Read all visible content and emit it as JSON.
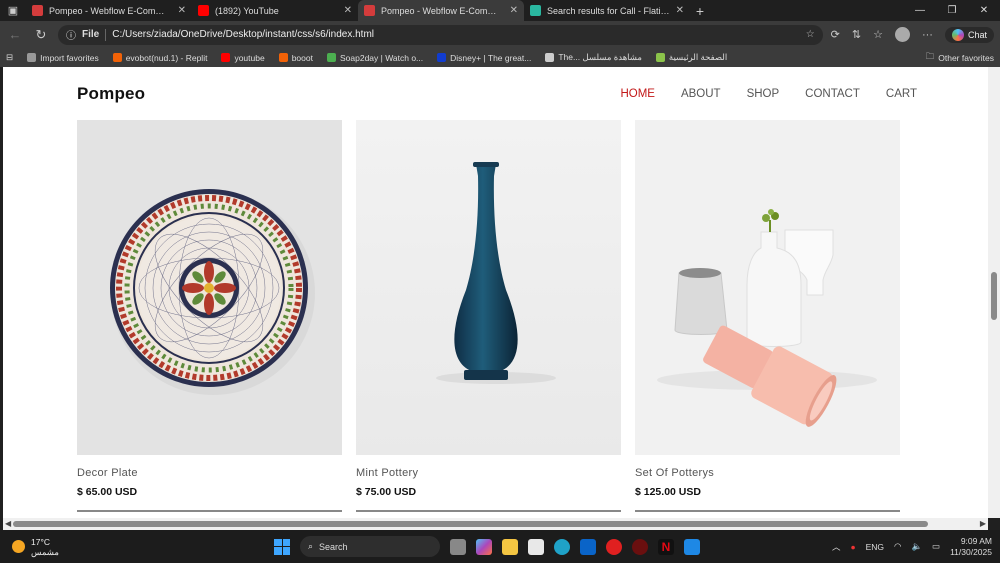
{
  "browser": {
    "tabs": [
      {
        "title": "Pompeo - Webflow E-Commerce",
        "active": false,
        "icon": "webflow-icon",
        "color": "#d43c3c"
      },
      {
        "title": "(1892) YouTube",
        "active": false,
        "icon": "youtube-icon",
        "color": "#ff0000"
      },
      {
        "title": "Pompeo - Webflow E-Commerce",
        "active": true,
        "icon": "webflow-icon",
        "color": "#d43c3c"
      },
      {
        "title": "Search results for Call - Flaticon",
        "active": false,
        "icon": "flaticon-icon",
        "color": "#2ab7a0"
      }
    ],
    "address": {
      "scheme_label": "File",
      "url": "C:/Users/ziada/OneDrive/Desktop/instant/css/s6/index.html"
    },
    "chat_label": "Chat",
    "favorites": [
      {
        "label": "Import favorites",
        "color": "#999999"
      },
      {
        "label": "evobot(nud.1) - Replit",
        "color": "#f26207"
      },
      {
        "label": "youtube",
        "color": "#ff0000"
      },
      {
        "label": "booot",
        "color": "#f26207"
      },
      {
        "label": "Soap2day | Watch o...",
        "color": "#4caf50"
      },
      {
        "label": "Disney+ | The great...",
        "color": "#113ccf"
      },
      {
        "label": "The... مشاهدة مسلسل",
        "color": "#cccccc"
      },
      {
        "label": "الصفحة الرئيسية",
        "color": "#8bc34a"
      }
    ],
    "other_favorites": "Other favorites"
  },
  "site": {
    "logo": "Pompeo",
    "nav": [
      {
        "label": "HOME",
        "active": true
      },
      {
        "label": "ABOUT",
        "active": false
      },
      {
        "label": "SHOP",
        "active": false
      },
      {
        "label": "CONTACT",
        "active": false
      },
      {
        "label": "CART",
        "active": false
      }
    ],
    "products": [
      {
        "name": "Decor Plate",
        "price": "$ 65.00 USD"
      },
      {
        "name": "Mint Pottery",
        "price": "$ 75.00 USD"
      },
      {
        "name": "Set Of Potterys",
        "price": "$ 125.00 USD"
      }
    ]
  },
  "taskbar": {
    "temperature": "17°C",
    "weather_text": "مشمس",
    "search_label": "Search",
    "lang": "ENG",
    "time": "9:09 AM",
    "date": "11/30/2025"
  }
}
